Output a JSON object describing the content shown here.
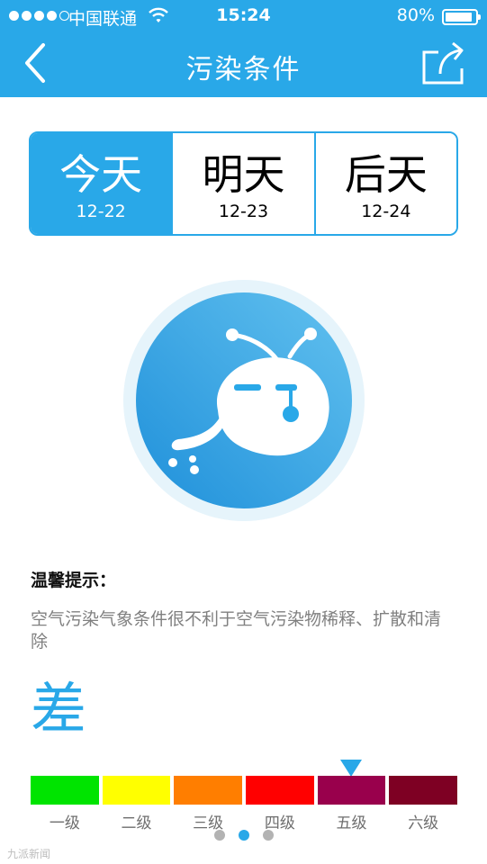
{
  "status_bar": {
    "carrier": "中国联通",
    "time": "15:24",
    "battery": "80%",
    "battery_level": 0.8,
    "signal_bars_filled": 4,
    "signal_bars_total": 5
  },
  "header": {
    "title": "污染条件",
    "back_icon": "chevron-left-icon",
    "share_icon": "share-icon"
  },
  "tabs": [
    {
      "label": "今天",
      "date": "12-22",
      "active": true
    },
    {
      "label": "明天",
      "date": "12-23",
      "active": false
    },
    {
      "label": "后天",
      "date": "12-24",
      "active": false
    }
  ],
  "mascot": {
    "icon": "sick-mascot-icon"
  },
  "tip": {
    "title": "温馨提示：",
    "text": "空气污染气象条件很不利于空气污染物稀释、扩散和清除"
  },
  "grade": "差",
  "scale": {
    "levels": [
      {
        "label": "一级",
        "color": "#00e400"
      },
      {
        "label": "二级",
        "color": "#ffff00"
      },
      {
        "label": "三级",
        "color": "#ff7e00"
      },
      {
        "label": "四级",
        "color": "#ff0000"
      },
      {
        "label": "五级",
        "color": "#99004c"
      },
      {
        "label": "六级",
        "color": "#7e0023"
      }
    ],
    "current_level": 5
  },
  "pager": {
    "pages": 3,
    "current": 2
  },
  "colors": {
    "accent": "#29a8e8"
  },
  "watermark": "九派新闻"
}
